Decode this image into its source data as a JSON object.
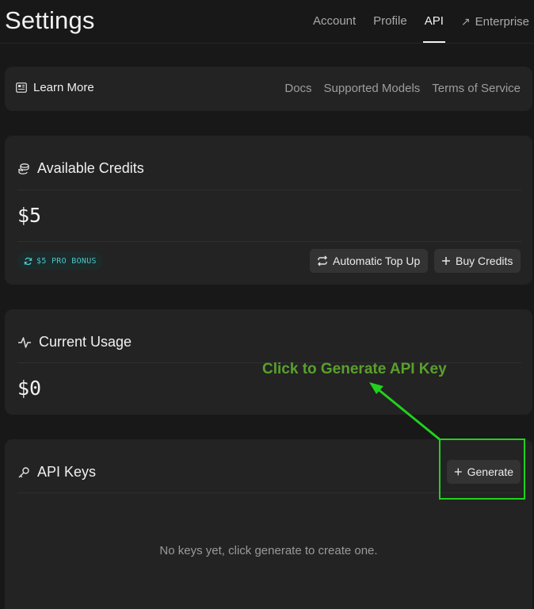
{
  "header": {
    "title": "Settings",
    "tabs": [
      {
        "label": "Account",
        "active": false
      },
      {
        "label": "Profile",
        "active": false
      },
      {
        "label": "API",
        "active": true
      },
      {
        "label": "Enterprise",
        "active": false,
        "external": true
      }
    ]
  },
  "learn_more": {
    "label": "Learn More",
    "icon": "newspaper-icon",
    "links": [
      "Docs",
      "Supported Models",
      "Terms of Service"
    ]
  },
  "credits": {
    "title": "Available Credits",
    "icon": "coins-icon",
    "amount": "$5",
    "badge": "$5 PRO BONUS",
    "badge_color": "#4ec3c6",
    "auto_topup_label": "Automatic Top Up",
    "buy_label": "Buy Credits"
  },
  "usage": {
    "title": "Current Usage",
    "icon": "activity-icon",
    "amount": "$0"
  },
  "api_keys": {
    "title": "API Keys",
    "icon": "key-icon",
    "generate_label": "Generate",
    "empty_message": "No keys yet, click generate to create one."
  },
  "annotation": {
    "text": "Click to Generate API Key",
    "text_color": "#5aa02c",
    "box_color": "#22d11d"
  }
}
